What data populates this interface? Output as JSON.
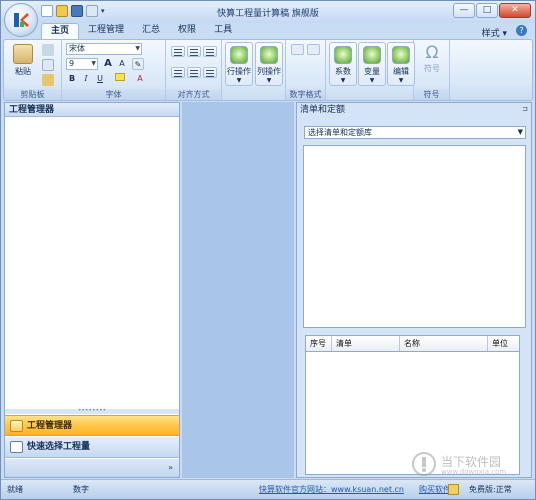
{
  "app": {
    "title": "快算工程量计算稿 旗舰版",
    "window_buttons": [
      "—",
      "□",
      "✕"
    ]
  },
  "tabs": [
    "主页",
    "工程管理",
    "汇总",
    "权限",
    "工具"
  ],
  "active_tab": "主页",
  "style_menu": "样式",
  "ribbon": {
    "clipboard": {
      "paste": "粘贴",
      "label": "剪贴板"
    },
    "font": {
      "name": "宋体",
      "size": "9",
      "bold": "B",
      "italic": "I",
      "underline": "U",
      "grow": "A",
      "shrink": "A",
      "color": "A",
      "label": "字体"
    },
    "align": {
      "label": "对齐方式"
    },
    "row_op": {
      "label": "行操作"
    },
    "col_op": {
      "label": "列操作"
    },
    "number": {
      "label": "数字格式"
    },
    "coef": {
      "label": "系数"
    },
    "var": {
      "label": "变量"
    },
    "edit": {
      "label": "编辑"
    },
    "symbol": {
      "glyph": "Ω",
      "btn": "符号",
      "label": "符号"
    }
  },
  "left_panel": {
    "title": "工程管理器",
    "nav_active": "工程管理器",
    "nav_second": "快速选择工程量",
    "more": "»"
  },
  "right_panel": {
    "title": "清单和定额",
    "select": "选择清单和定额库",
    "columns": [
      "序号",
      "清单",
      "名称",
      "单位"
    ]
  },
  "status": {
    "ready": "就绪",
    "num": "数字",
    "site": "快算软件官方网站：www.ksuan.net.cn",
    "buy": "购买软件",
    "free": "免费版:正常"
  },
  "watermark": {
    "text": "当下软件园",
    "url": "www.downxia.com"
  },
  "colors": {
    "accent": "#3a78c8",
    "nav_active": "#ffc64a",
    "center_bg": "#a9c6ea"
  }
}
